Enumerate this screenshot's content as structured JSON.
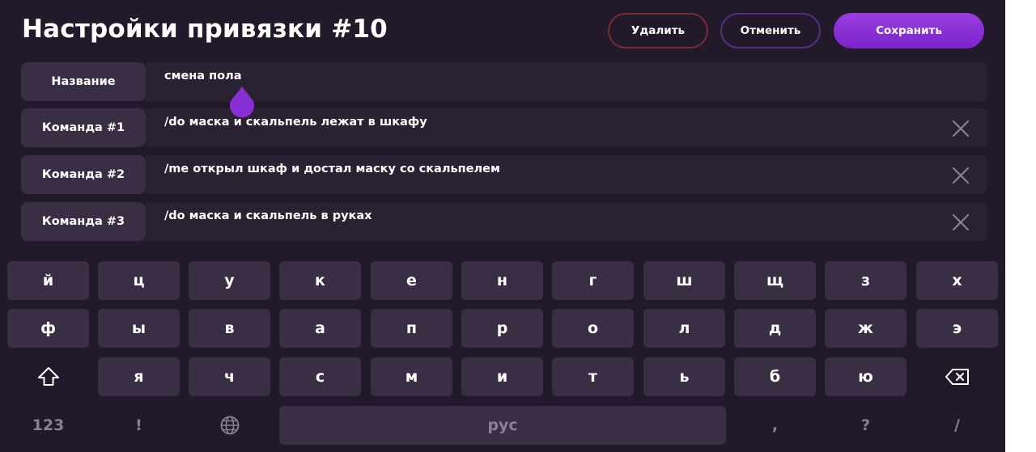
{
  "header": {
    "title": "Настройки привязки #10",
    "delete_label": "Удалить",
    "cancel_label": "Отменить",
    "save_label": "Сохранить"
  },
  "rows": [
    {
      "label": "Название",
      "value": "смена пола"
    },
    {
      "label": "Команда #1",
      "value": "/do маска и скальпель лежат в шкафу"
    },
    {
      "label": "Команда #2",
      "value": "/me открыл шкаф и достал маску со скальпелем"
    },
    {
      "label": "Команда #3",
      "value": "/do маска и скальпель в руках"
    }
  ],
  "keyboard": {
    "row1": [
      "й",
      "ц",
      "у",
      "к",
      "е",
      "н",
      "г",
      "ш",
      "щ",
      "з",
      "х"
    ],
    "row2": [
      "ф",
      "ы",
      "в",
      "а",
      "п",
      "р",
      "о",
      "л",
      "д",
      "ж",
      "э"
    ],
    "row3": [
      "я",
      "ч",
      "с",
      "м",
      "и",
      "т",
      "ь",
      "б",
      "ю"
    ],
    "row4": {
      "numbers": "123",
      "excl": "!",
      "space": "рус",
      "comma": ",",
      "question": "?",
      "slash": "/"
    },
    "icons": {
      "shift": "shift-icon",
      "backspace": "backspace-icon",
      "language": "globe-icon",
      "close": "close-icon",
      "cursor": "text-cursor-handle-icon"
    }
  },
  "colors": {
    "background": "#221a2a",
    "field": "#2a2132",
    "label_bg": "#3a2e44",
    "accent": "#8a2fd6",
    "delete_border": "#7b2a36",
    "cancel_border": "#53307e"
  }
}
